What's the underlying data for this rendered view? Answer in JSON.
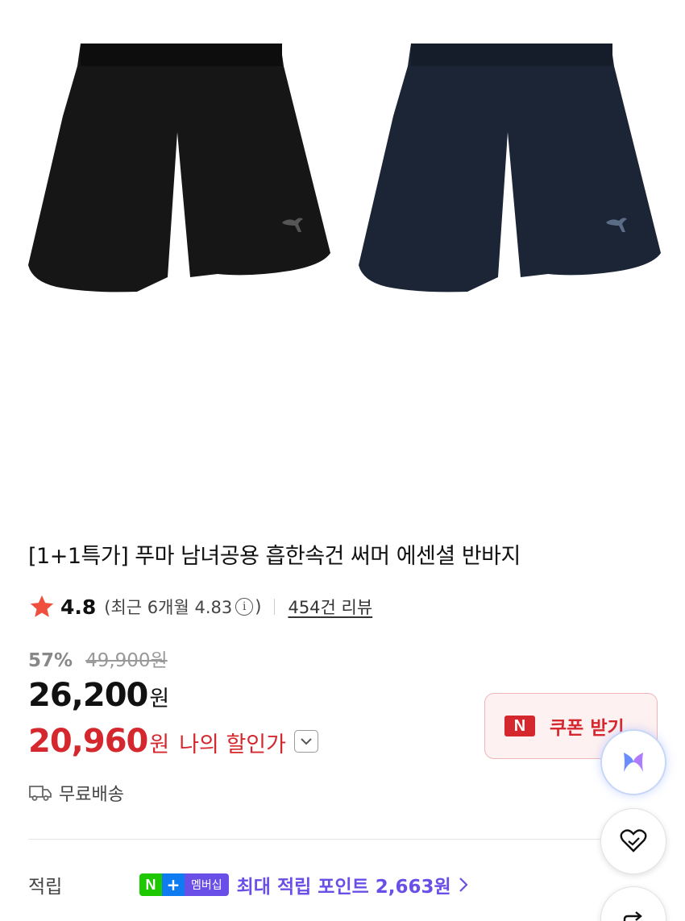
{
  "product": {
    "title": "[1+1특가] 푸마 남녀공용 흡한속건 써머 에센셜 반바지"
  },
  "rating": {
    "score": "4.8",
    "recent_text": "(최근 6개월 4.83",
    "recent_close": ")",
    "review_link": "454건 리뷰"
  },
  "price": {
    "discount_rate": "57%",
    "original": "49,900원",
    "sale_num": "26,200",
    "sale_unit": "원",
    "my_num": "20,960",
    "my_unit": "원",
    "my_label": "나의 할인가"
  },
  "coupon": {
    "logo": "N",
    "label": "쿠폰 받기"
  },
  "shipping": {
    "label": "무료배송"
  },
  "points": {
    "label": "적립",
    "badge_n": "N",
    "badge_plus": "+",
    "badge_member": "멤버십",
    "text": "최대 적립 포인트 2,663원"
  },
  "colors": {
    "accent_red": "#d4282e",
    "naver_green": "#1ec800",
    "membership_purple": "#6a4ee8"
  },
  "icons": [
    "star-icon",
    "info-icon",
    "chevron-down-icon",
    "truck-icon",
    "chevron-right-icon",
    "ai-icon",
    "heart-icon",
    "share-icon"
  ]
}
